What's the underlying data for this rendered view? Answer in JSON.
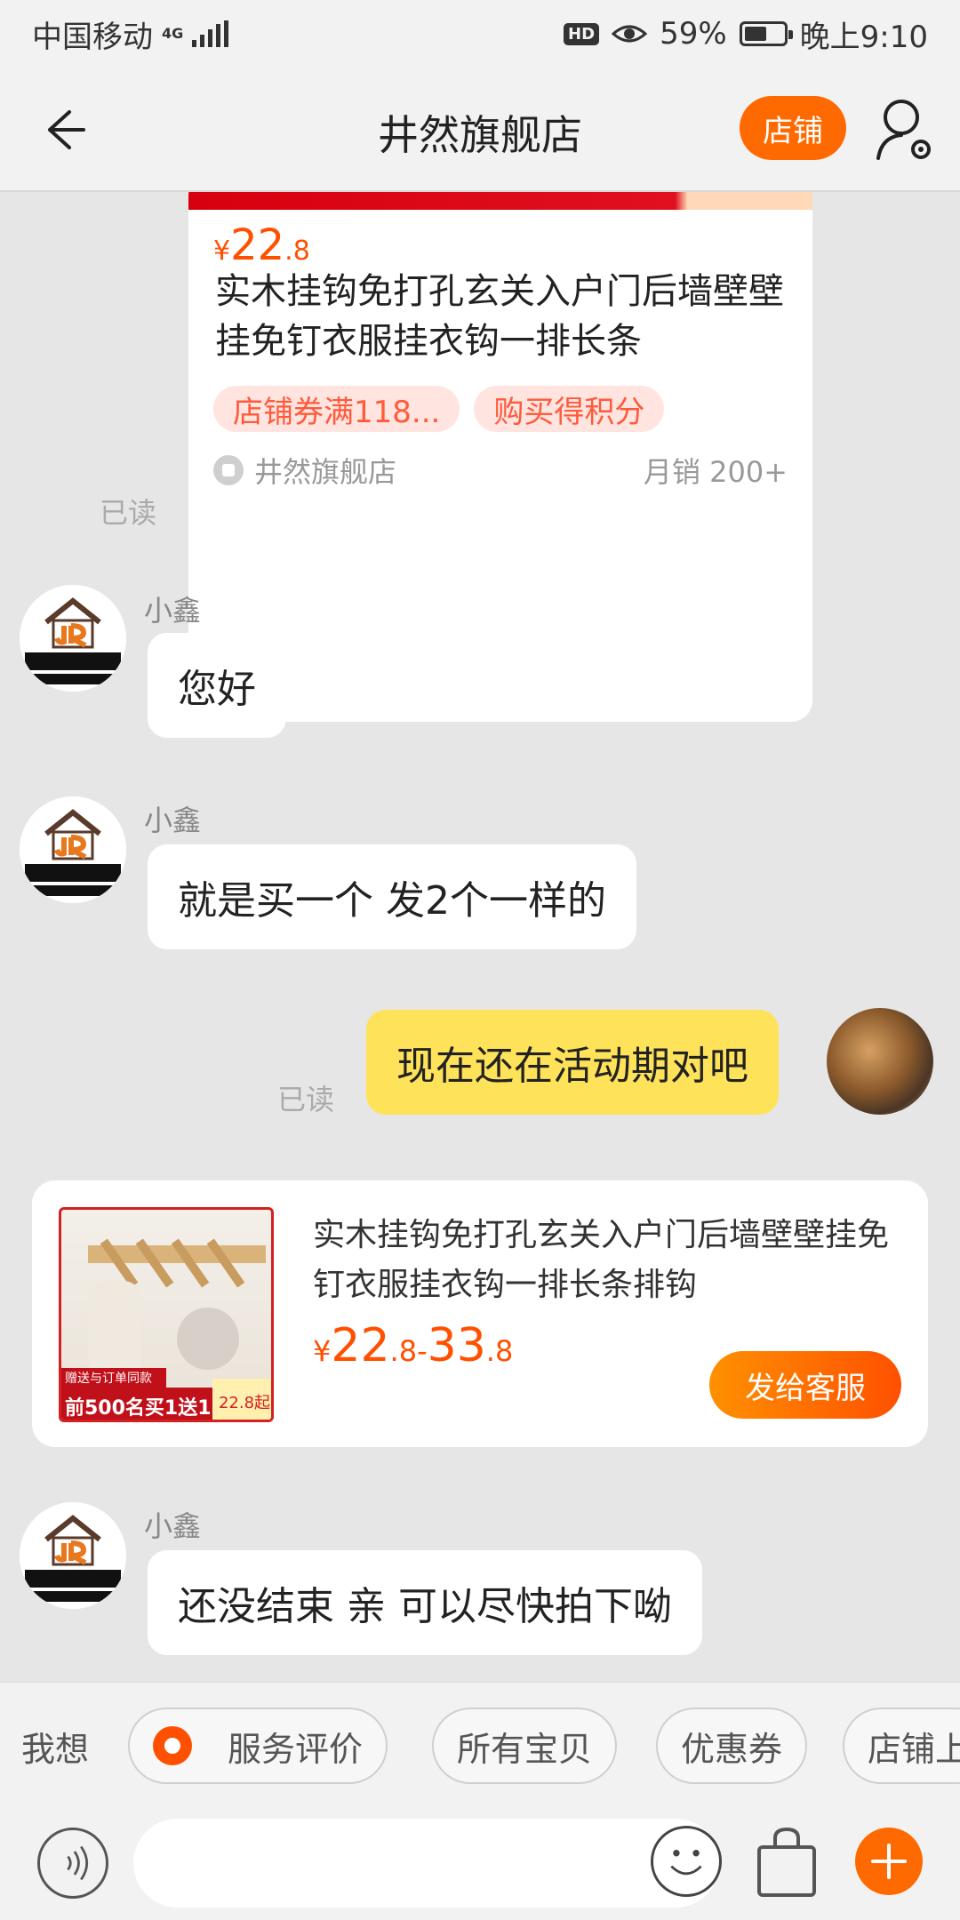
{
  "status_bar": {
    "carrier": "中国移动",
    "network": "4G",
    "battery": "59%",
    "battery_level": 0.59,
    "time": "晚上9:10",
    "hd_badge": "HD"
  },
  "header": {
    "title": "井然旗舰店",
    "shop_button": "店铺"
  },
  "top_product": {
    "price_symbol": "¥",
    "price_int": "22",
    "price_dec": ".8",
    "title": "实木挂钩免打孔玄关入户门后墙壁壁挂免钉衣服挂衣钩一排长条",
    "tags": [
      "店铺券满118...",
      "购买得积分"
    ],
    "shop_name": "井然旗舰店",
    "sales": "月销 200+"
  },
  "read_label": "已读",
  "messages": [
    {
      "sender": "小鑫",
      "text": "您好"
    },
    {
      "sender": "小鑫",
      "text": "就是买一个 发2个一样的"
    },
    {
      "text": "现在还在活动期对吧"
    },
    {
      "sender": "小鑫",
      "text": "还没结束 亲 可以尽快拍下呦"
    }
  ],
  "product_card": {
    "title": "实木挂钩免打孔玄关入户门后墙壁壁挂免钉衣服挂衣钩一排长条排钩",
    "price_symbol": "¥",
    "price_low_int": "22",
    "price_low_dec": ".8",
    "price_sep": "-",
    "price_high_int": "33",
    "price_high_dec": ".8",
    "thumb_promo_small": "赠送与订单同款",
    "thumb_promo_big": "前500名买1送1",
    "thumb_price": "22.8起",
    "send_button": "发给客服"
  },
  "quick_actions": {
    "label": "我想",
    "chips": [
      "服务评价",
      "所有宝贝",
      "优惠券",
      "店铺上"
    ]
  },
  "colors": {
    "accent": "#ff6a00",
    "price": "#ff5000",
    "my_bubble": "#fee25a"
  }
}
